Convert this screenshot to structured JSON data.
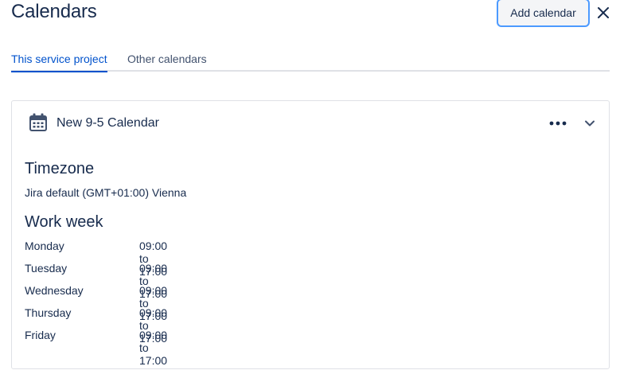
{
  "header": {
    "title": "Calendars",
    "add_button_label": "Add calendar",
    "close_icon": "close-icon"
  },
  "tabs": [
    {
      "label": "This service project",
      "active": true
    },
    {
      "label": "Other calendars",
      "active": false
    }
  ],
  "calendar": {
    "icon": "calendar-icon",
    "name": "New 9-5 Calendar",
    "timezone_heading": "Timezone",
    "timezone_value": "Jira default (GMT+01:00) Vienna",
    "workweek_heading": "Work week",
    "days": [
      {
        "day": "Monday",
        "hours": "09:00 to 17:00"
      },
      {
        "day": "Tuesday",
        "hours": "09:00 to 17:00"
      },
      {
        "day": "Wednesday",
        "hours": "09:00 to 17:00"
      },
      {
        "day": "Thursday",
        "hours": "09:00 to 17:00"
      },
      {
        "day": "Friday",
        "hours": "09:00 to 17:00"
      }
    ]
  },
  "colors": {
    "accent": "#0052CC",
    "focus_ring": "#4C9AFF",
    "text": "#172B4D"
  }
}
